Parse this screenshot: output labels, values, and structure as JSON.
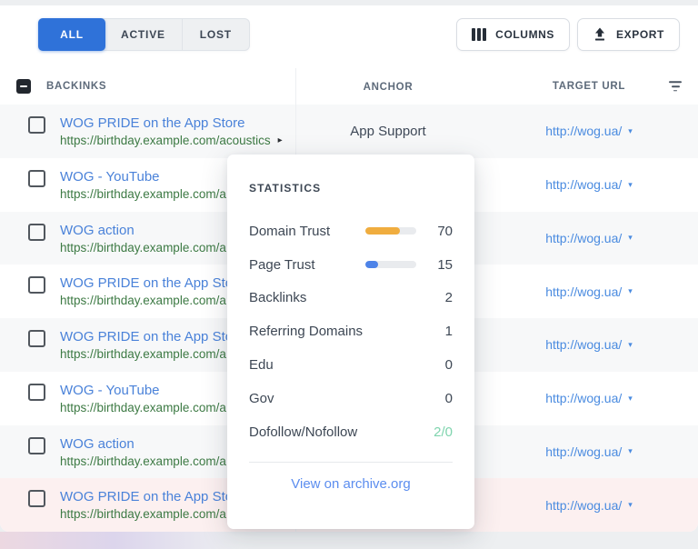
{
  "toolbar": {
    "tabs": [
      {
        "label": "ALL",
        "active": true
      },
      {
        "label": "ACTIVE",
        "active": false
      },
      {
        "label": "LOST",
        "active": false
      }
    ],
    "columns_label": "COLUMNS",
    "export_label": "EXPORT"
  },
  "table": {
    "headers": {
      "backlinks": "BACKINKS",
      "anchor": "ANCHOR",
      "target_url": "TARGET URL"
    },
    "header_checkbox_state": "indeterminate",
    "rows": [
      {
        "title": "WOG PRIDE on the App Store",
        "url": "https://birthday.example.com/acoustics",
        "expander": true,
        "anchor": "App Support",
        "target": "http://wog.ua/",
        "state": "normal"
      },
      {
        "title": "WOG - YouTube",
        "url": "https://birthday.example.com/a",
        "expander": false,
        "anchor": "",
        "target": "http://wog.ua/",
        "state": "normal"
      },
      {
        "title": "WOG action",
        "url": "https://birthday.example.com/a",
        "expander": false,
        "anchor": "",
        "target": "http://wog.ua/",
        "state": "normal"
      },
      {
        "title": "WOG PRIDE on the App Store",
        "url": "https://birthday.example.com/a",
        "expander": false,
        "anchor": "",
        "target": "http://wog.ua/",
        "state": "normal"
      },
      {
        "title": "WOG PRIDE on the App Store",
        "url": "https://birthday.example.com/a",
        "expander": false,
        "anchor": "",
        "target": "http://wog.ua/",
        "state": "normal"
      },
      {
        "title": "WOG - YouTube",
        "url": "https://birthday.example.com/a",
        "expander": false,
        "anchor": "",
        "target": "http://wog.ua/",
        "state": "normal"
      },
      {
        "title": "WOG action",
        "url": "https://birthday.example.com/a",
        "expander": false,
        "anchor": "",
        "target": "http://wog.ua/",
        "state": "normal"
      },
      {
        "title": "WOG PRIDE on the App Store",
        "url": "https://birthday.example.com/a",
        "expander": false,
        "anchor": "",
        "target": "http://wog.ua/",
        "state": "lost"
      }
    ]
  },
  "popup": {
    "title": "STATISTICS",
    "stats": [
      {
        "label": "Domain Trust",
        "value": "70",
        "bar_percent": 68,
        "bar_color": "#f0ad3f"
      },
      {
        "label": "Page Trust",
        "value": "15",
        "bar_percent": 25,
        "bar_color": "#4d83e8"
      },
      {
        "label": "Backlinks",
        "value": "2"
      },
      {
        "label": "Referring Domains",
        "value": "1"
      },
      {
        "label": "Edu",
        "value": "0"
      },
      {
        "label": "Gov",
        "value": "0"
      },
      {
        "label": "Dofollow/Nofollow",
        "value": "2/0",
        "value_color": "#7fd4ae"
      }
    ],
    "link_label": "View on archive.org"
  },
  "colors": {
    "accent_blue": "#2f72d9",
    "link_blue": "#4a82d9",
    "url_green": "#3d7a44",
    "target_blue": "#4a8be0",
    "lost_row_bg": "#fcf0f0",
    "alt_row_bg": "#f7f8f9",
    "dofollow_green": "#7fd4ae",
    "bar_orange": "#f0ad3f",
    "bar_blue": "#4d83e8"
  }
}
